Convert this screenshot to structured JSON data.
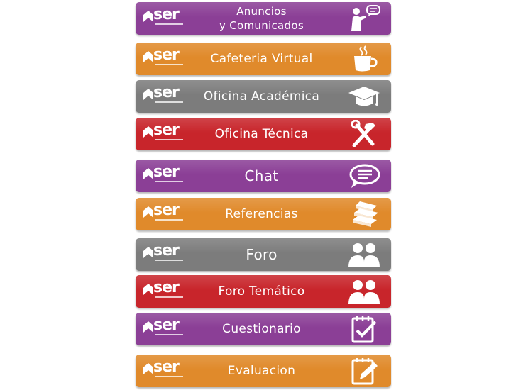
{
  "colors": {
    "purple": "#8b3f96",
    "orange": "#e08a2b",
    "gray": "#7c7c7c",
    "red": "#c8252b",
    "icon": "#ffffff"
  },
  "brand": {
    "logo_text": "ser"
  },
  "menu": [
    {
      "label_line1": "Anuncios",
      "label_line2": "y Comunicados",
      "icon": "presenter-speech-icon"
    },
    {
      "label": "Cafeteria Virtual",
      "icon": "coffee-cup-icon"
    },
    {
      "label": "Oficina Académica",
      "icon": "graduation-cap-icon"
    },
    {
      "label": "Oficina Técnica",
      "icon": "tools-icon"
    },
    {
      "label": "Chat",
      "icon": "chat-bubble-icon"
    },
    {
      "label": "Referencias",
      "icon": "books-icon"
    },
    {
      "label": "Foro",
      "icon": "people-icon"
    },
    {
      "label": "Foro Temático",
      "icon": "people-icon"
    },
    {
      "label": "Cuestionario",
      "icon": "checklist-icon"
    },
    {
      "label": "Evaluacion",
      "icon": "notepad-pencil-icon"
    }
  ]
}
